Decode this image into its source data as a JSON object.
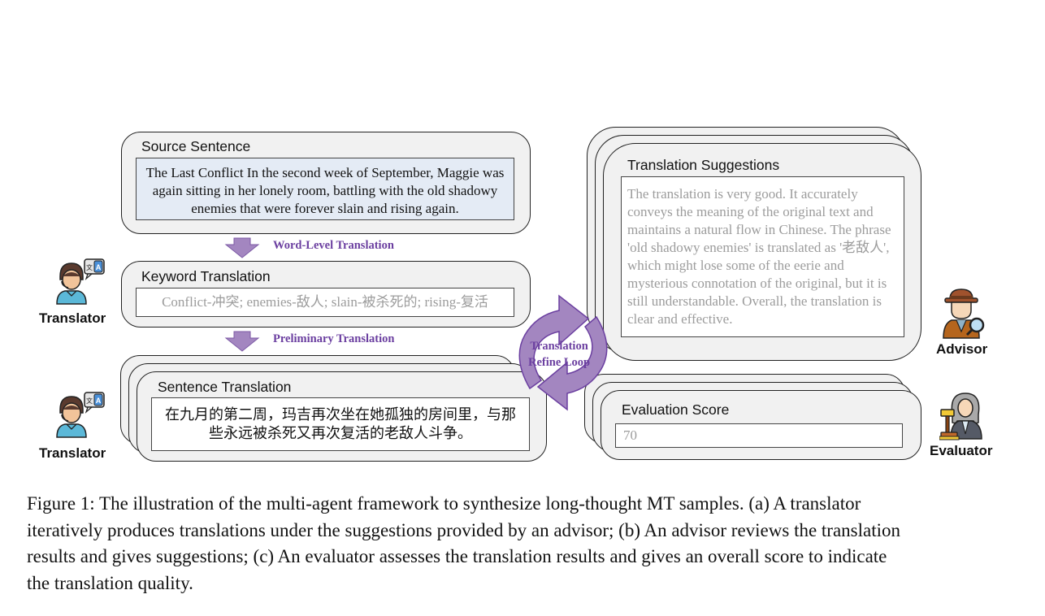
{
  "source": {
    "title": "Source Sentence",
    "text": "The Last Conflict In the second week of September, Maggie was again sitting in her lonely room, battling with the old shadowy enemies that were forever slain and rising again."
  },
  "flow": {
    "step1_label": "Word-Level Translation",
    "step2_label": "Preliminary Translation",
    "loop_label_line1": "Translation",
    "loop_label_line2": "Refine Loop"
  },
  "keyword": {
    "title": "Keyword Translation",
    "text": "Conflict-冲突; enemies-敌人; slain-被杀死的; rising-复活"
  },
  "sentence": {
    "title": "Sentence Translation",
    "text_line1": "在九月的第二周，玛吉再次坐在她孤独的房间里，与那",
    "text_line2": "些永远被杀死又再次复活的老敌人斗争。"
  },
  "suggestions": {
    "title": "Translation Suggestions",
    "text": "The translation is very good. It accurately conveys the meaning of the original text and maintains a natural flow in Chinese. The phrase 'old shadowy enemies' is translated as '老敌人', which might lose some of the eerie and mysterious connotation of the original, but it is still understandable. Overall, the translation is clear and effective."
  },
  "evaluation": {
    "title": "Evaluation Score",
    "score": "70"
  },
  "agents": {
    "translator_top": "Translator",
    "translator_bottom": "Translator",
    "advisor": "Advisor",
    "evaluator": "Evaluator"
  },
  "icons": {
    "translator": "translator-person-icon",
    "advisor": "detective-magnifier-icon",
    "evaluator": "judge-gavel-icon",
    "flow_arrow": "down-arrow-icon",
    "loop": "circular-refresh-arrows-icon"
  },
  "colors": {
    "accent_purple": "#6b3fa0",
    "arrow_purple": "#a386c0",
    "card_bg": "#f1f1f1",
    "source_bg": "#e4ebf5",
    "muted_text": "#9c9c9c"
  },
  "caption": {
    "line1": "Figure 1: The illustration of the multi-agent framework to synthesize long-thought MT samples. (a) A translator",
    "line2": "iteratively produces translations under the suggestions provided by an advisor; (b) An advisor reviews the translation",
    "line3": "results and gives suggestions; (c) An evaluator assesses the translation results and gives an overall score to indicate",
    "line4": "the translation quality."
  }
}
